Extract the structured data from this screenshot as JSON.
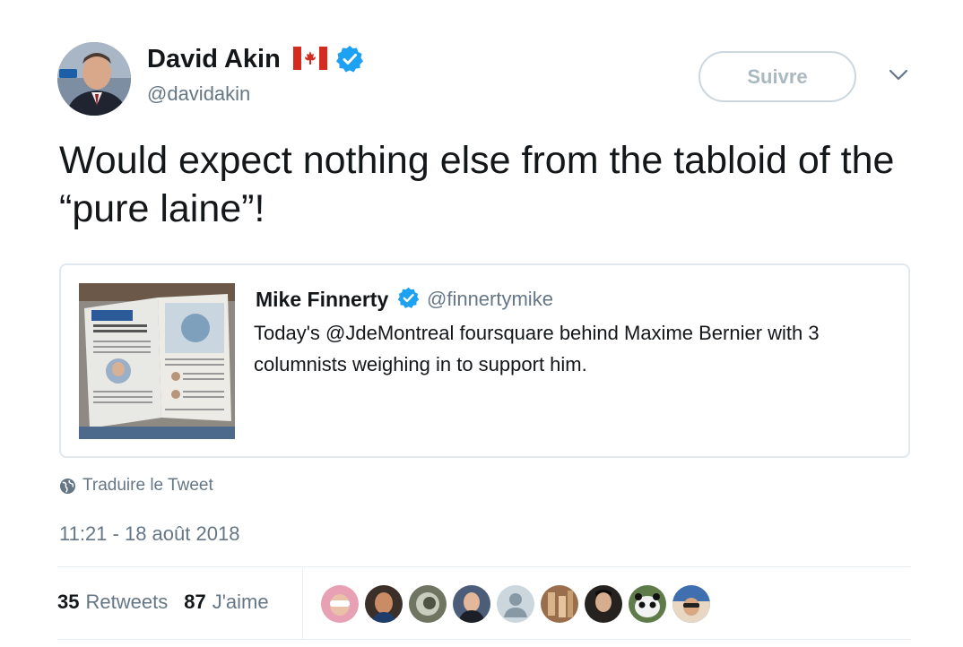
{
  "author": {
    "name": "David Akin",
    "handle": "@davidakin"
  },
  "follow_button_label": "Suivre",
  "tweet_text": "Would expect nothing else from the tabloid of the “pure laine”!",
  "quoted_tweet": {
    "name": "Mike Finnerty",
    "handle": "@finnertymike",
    "text": "Today's @JdeMontreal foursquare behind Maxime Bernier with 3 columnists weighing in to support him."
  },
  "translate_label": "Traduire le Tweet",
  "timestamp": "11:21 - 18 août 2018",
  "stats": {
    "retweets_count": "35",
    "retweets_label": "Retweets",
    "likes_count": "87",
    "likes_label": "J'aime"
  },
  "icons": {
    "verified": "verified-badge-icon",
    "flag": "canada-flag-icon",
    "menu": "chevron-down-icon",
    "translate": "globe-icon"
  },
  "colors": {
    "verified_blue": "#1da1f2",
    "muted_text": "#657786",
    "border": "#e1e8ed",
    "flag_red": "#d52b1e"
  }
}
